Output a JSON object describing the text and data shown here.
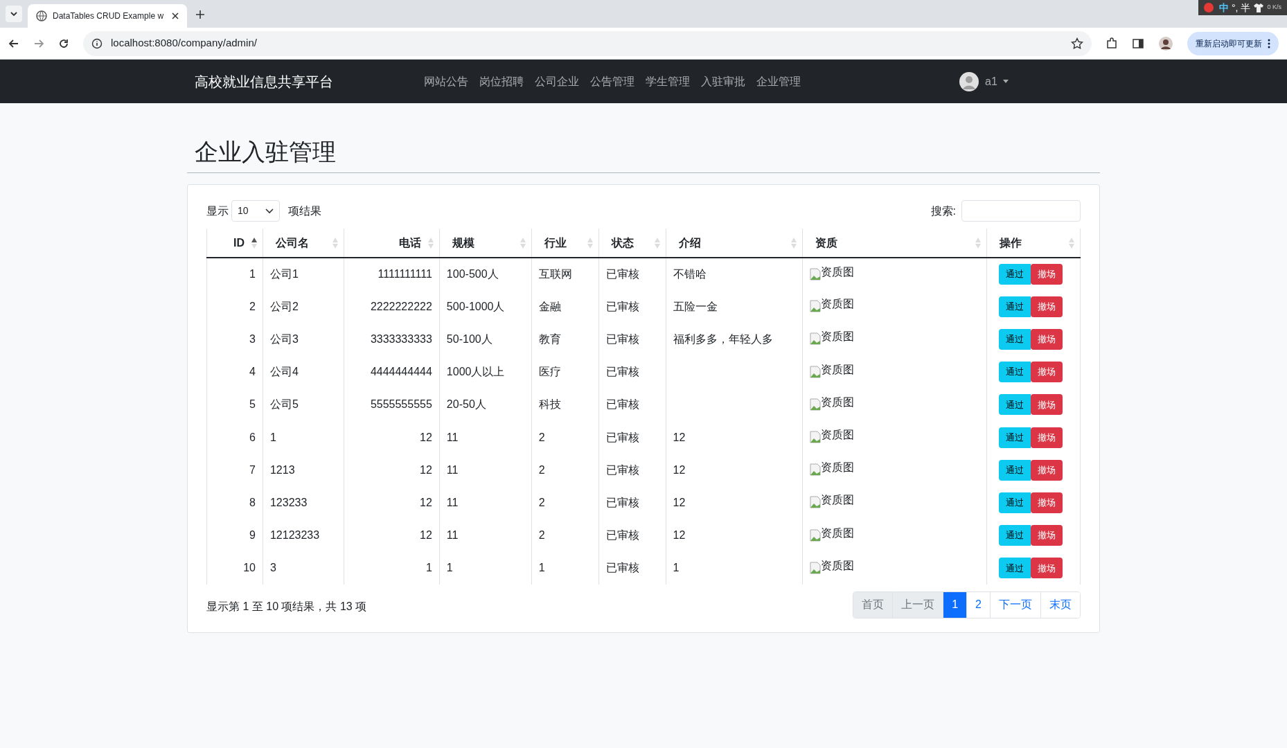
{
  "browser": {
    "tab_title": "DataTables CRUD Example w",
    "url": "localhost:8080/company/admin/",
    "update_button": "重新启动即可更新",
    "tray": [
      "中",
      "°,",
      "半"
    ],
    "net_speed": "0 K/s"
  },
  "navbar": {
    "brand": "高校就业信息共享平台",
    "links": [
      "网站公告",
      "岗位招聘",
      "公司企业",
      "公告管理",
      "学生管理",
      "入驻审批",
      "企业管理"
    ],
    "user": "a1"
  },
  "page_title": "企业入驻管理",
  "length_menu": {
    "prefix": "显示",
    "value": "10",
    "suffix": "项结果"
  },
  "search": {
    "label": "搜索:"
  },
  "table": {
    "columns": [
      {
        "label": "ID",
        "kind": "number",
        "sorted": true
      },
      {
        "label": "公司名",
        "kind": "text",
        "sorted": false
      },
      {
        "label": "电话",
        "kind": "number",
        "sorted": false
      },
      {
        "label": "规模",
        "kind": "text",
        "sorted": false
      },
      {
        "label": "行业",
        "kind": "text",
        "sorted": false
      },
      {
        "label": "状态",
        "kind": "text",
        "sorted": false
      },
      {
        "label": "介绍",
        "kind": "text",
        "sorted": false
      },
      {
        "label": "资质",
        "kind": "image",
        "sorted": false
      },
      {
        "label": "操作",
        "kind": "actions",
        "sorted": false
      }
    ],
    "rows": [
      {
        "cells": [
          "1",
          "公司1",
          "1111111111",
          "100-500人",
          "互联网",
          "已审核",
          "不错哈",
          "资质图"
        ],
        "actions": [
          "通过",
          "撤场"
        ]
      },
      {
        "cells": [
          "2",
          "公司2",
          "2222222222",
          "500-1000人",
          "金融",
          "已审核",
          "五险一金",
          "资质图"
        ],
        "actions": [
          "通过",
          "撤场"
        ]
      },
      {
        "cells": [
          "3",
          "公司3",
          "3333333333",
          "50-100人",
          "教育",
          "已审核",
          "福利多多，年轻人多",
          "资质图"
        ],
        "actions": [
          "通过",
          "撤场"
        ]
      },
      {
        "cells": [
          "4",
          "公司4",
          "4444444444",
          "1000人以上",
          "医疗",
          "已审核",
          "",
          "资质图"
        ],
        "actions": [
          "通过",
          "撤场"
        ]
      },
      {
        "cells": [
          "5",
          "公司5",
          "5555555555",
          "20-50人",
          "科技",
          "已审核",
          "",
          "资质图"
        ],
        "actions": [
          "通过",
          "撤场"
        ]
      },
      {
        "cells": [
          "6",
          "1",
          "12",
          "11",
          "2",
          "已审核",
          "12",
          "资质图"
        ],
        "actions": [
          "通过",
          "撤场"
        ]
      },
      {
        "cells": [
          "7",
          "1213",
          "12",
          "11",
          "2",
          "已审核",
          "12",
          "资质图"
        ],
        "actions": [
          "通过",
          "撤场"
        ]
      },
      {
        "cells": [
          "8",
          "123233",
          "12",
          "11",
          "2",
          "已审核",
          "12",
          "资质图"
        ],
        "actions": [
          "通过",
          "撤场"
        ]
      },
      {
        "cells": [
          "9",
          "12123233",
          "12",
          "11",
          "2",
          "已审核",
          "12",
          "资质图"
        ],
        "actions": [
          "通过",
          "撤场"
        ]
      },
      {
        "cells": [
          "10",
          "3",
          "1",
          "1",
          "1",
          "已审核",
          "1",
          "资质图"
        ],
        "actions": [
          "通过",
          "撤场"
        ]
      }
    ]
  },
  "info": "显示第 1 至 10 项结果，共 13 项",
  "pagination": [
    {
      "label": "首页",
      "selected": false,
      "disabled": true
    },
    {
      "label": "上一页",
      "selected": false,
      "disabled": true
    },
    {
      "label": "1",
      "selected": true,
      "disabled": false
    },
    {
      "label": "2",
      "selected": false,
      "disabled": false
    },
    {
      "label": "下一页",
      "selected": false,
      "disabled": false
    },
    {
      "label": "末页",
      "selected": false,
      "disabled": false
    }
  ]
}
